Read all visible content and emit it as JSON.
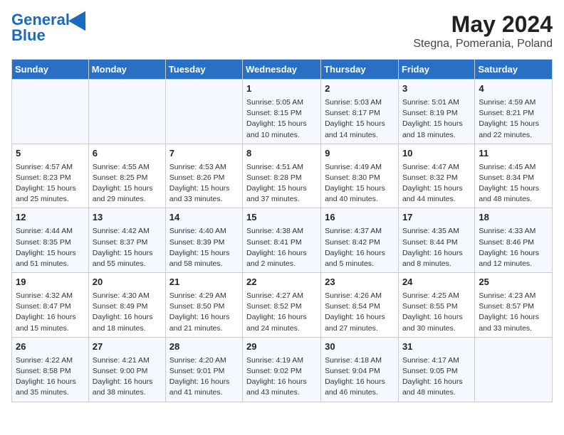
{
  "header": {
    "logo_line1": "General",
    "logo_line2": "Blue",
    "title": "May 2024",
    "subtitle": "Stegna, Pomerania, Poland"
  },
  "days_of_week": [
    "Sunday",
    "Monday",
    "Tuesday",
    "Wednesday",
    "Thursday",
    "Friday",
    "Saturday"
  ],
  "weeks": [
    [
      {
        "day": "",
        "info": ""
      },
      {
        "day": "",
        "info": ""
      },
      {
        "day": "",
        "info": ""
      },
      {
        "day": "1",
        "info": "Sunrise: 5:05 AM\nSunset: 8:15 PM\nDaylight: 15 hours\nand 10 minutes."
      },
      {
        "day": "2",
        "info": "Sunrise: 5:03 AM\nSunset: 8:17 PM\nDaylight: 15 hours\nand 14 minutes."
      },
      {
        "day": "3",
        "info": "Sunrise: 5:01 AM\nSunset: 8:19 PM\nDaylight: 15 hours\nand 18 minutes."
      },
      {
        "day": "4",
        "info": "Sunrise: 4:59 AM\nSunset: 8:21 PM\nDaylight: 15 hours\nand 22 minutes."
      }
    ],
    [
      {
        "day": "5",
        "info": "Sunrise: 4:57 AM\nSunset: 8:23 PM\nDaylight: 15 hours\nand 25 minutes."
      },
      {
        "day": "6",
        "info": "Sunrise: 4:55 AM\nSunset: 8:25 PM\nDaylight: 15 hours\nand 29 minutes."
      },
      {
        "day": "7",
        "info": "Sunrise: 4:53 AM\nSunset: 8:26 PM\nDaylight: 15 hours\nand 33 minutes."
      },
      {
        "day": "8",
        "info": "Sunrise: 4:51 AM\nSunset: 8:28 PM\nDaylight: 15 hours\nand 37 minutes."
      },
      {
        "day": "9",
        "info": "Sunrise: 4:49 AM\nSunset: 8:30 PM\nDaylight: 15 hours\nand 40 minutes."
      },
      {
        "day": "10",
        "info": "Sunrise: 4:47 AM\nSunset: 8:32 PM\nDaylight: 15 hours\nand 44 minutes."
      },
      {
        "day": "11",
        "info": "Sunrise: 4:45 AM\nSunset: 8:34 PM\nDaylight: 15 hours\nand 48 minutes."
      }
    ],
    [
      {
        "day": "12",
        "info": "Sunrise: 4:44 AM\nSunset: 8:35 PM\nDaylight: 15 hours\nand 51 minutes."
      },
      {
        "day": "13",
        "info": "Sunrise: 4:42 AM\nSunset: 8:37 PM\nDaylight: 15 hours\nand 55 minutes."
      },
      {
        "day": "14",
        "info": "Sunrise: 4:40 AM\nSunset: 8:39 PM\nDaylight: 15 hours\nand 58 minutes."
      },
      {
        "day": "15",
        "info": "Sunrise: 4:38 AM\nSunset: 8:41 PM\nDaylight: 16 hours\nand 2 minutes."
      },
      {
        "day": "16",
        "info": "Sunrise: 4:37 AM\nSunset: 8:42 PM\nDaylight: 16 hours\nand 5 minutes."
      },
      {
        "day": "17",
        "info": "Sunrise: 4:35 AM\nSunset: 8:44 PM\nDaylight: 16 hours\nand 8 minutes."
      },
      {
        "day": "18",
        "info": "Sunrise: 4:33 AM\nSunset: 8:46 PM\nDaylight: 16 hours\nand 12 minutes."
      }
    ],
    [
      {
        "day": "19",
        "info": "Sunrise: 4:32 AM\nSunset: 8:47 PM\nDaylight: 16 hours\nand 15 minutes."
      },
      {
        "day": "20",
        "info": "Sunrise: 4:30 AM\nSunset: 8:49 PM\nDaylight: 16 hours\nand 18 minutes."
      },
      {
        "day": "21",
        "info": "Sunrise: 4:29 AM\nSunset: 8:50 PM\nDaylight: 16 hours\nand 21 minutes."
      },
      {
        "day": "22",
        "info": "Sunrise: 4:27 AM\nSunset: 8:52 PM\nDaylight: 16 hours\nand 24 minutes."
      },
      {
        "day": "23",
        "info": "Sunrise: 4:26 AM\nSunset: 8:54 PM\nDaylight: 16 hours\nand 27 minutes."
      },
      {
        "day": "24",
        "info": "Sunrise: 4:25 AM\nSunset: 8:55 PM\nDaylight: 16 hours\nand 30 minutes."
      },
      {
        "day": "25",
        "info": "Sunrise: 4:23 AM\nSunset: 8:57 PM\nDaylight: 16 hours\nand 33 minutes."
      }
    ],
    [
      {
        "day": "26",
        "info": "Sunrise: 4:22 AM\nSunset: 8:58 PM\nDaylight: 16 hours\nand 35 minutes."
      },
      {
        "day": "27",
        "info": "Sunrise: 4:21 AM\nSunset: 9:00 PM\nDaylight: 16 hours\nand 38 minutes."
      },
      {
        "day": "28",
        "info": "Sunrise: 4:20 AM\nSunset: 9:01 PM\nDaylight: 16 hours\nand 41 minutes."
      },
      {
        "day": "29",
        "info": "Sunrise: 4:19 AM\nSunset: 9:02 PM\nDaylight: 16 hours\nand 43 minutes."
      },
      {
        "day": "30",
        "info": "Sunrise: 4:18 AM\nSunset: 9:04 PM\nDaylight: 16 hours\nand 46 minutes."
      },
      {
        "day": "31",
        "info": "Sunrise: 4:17 AM\nSunset: 9:05 PM\nDaylight: 16 hours\nand 48 minutes."
      },
      {
        "day": "",
        "info": ""
      }
    ]
  ]
}
